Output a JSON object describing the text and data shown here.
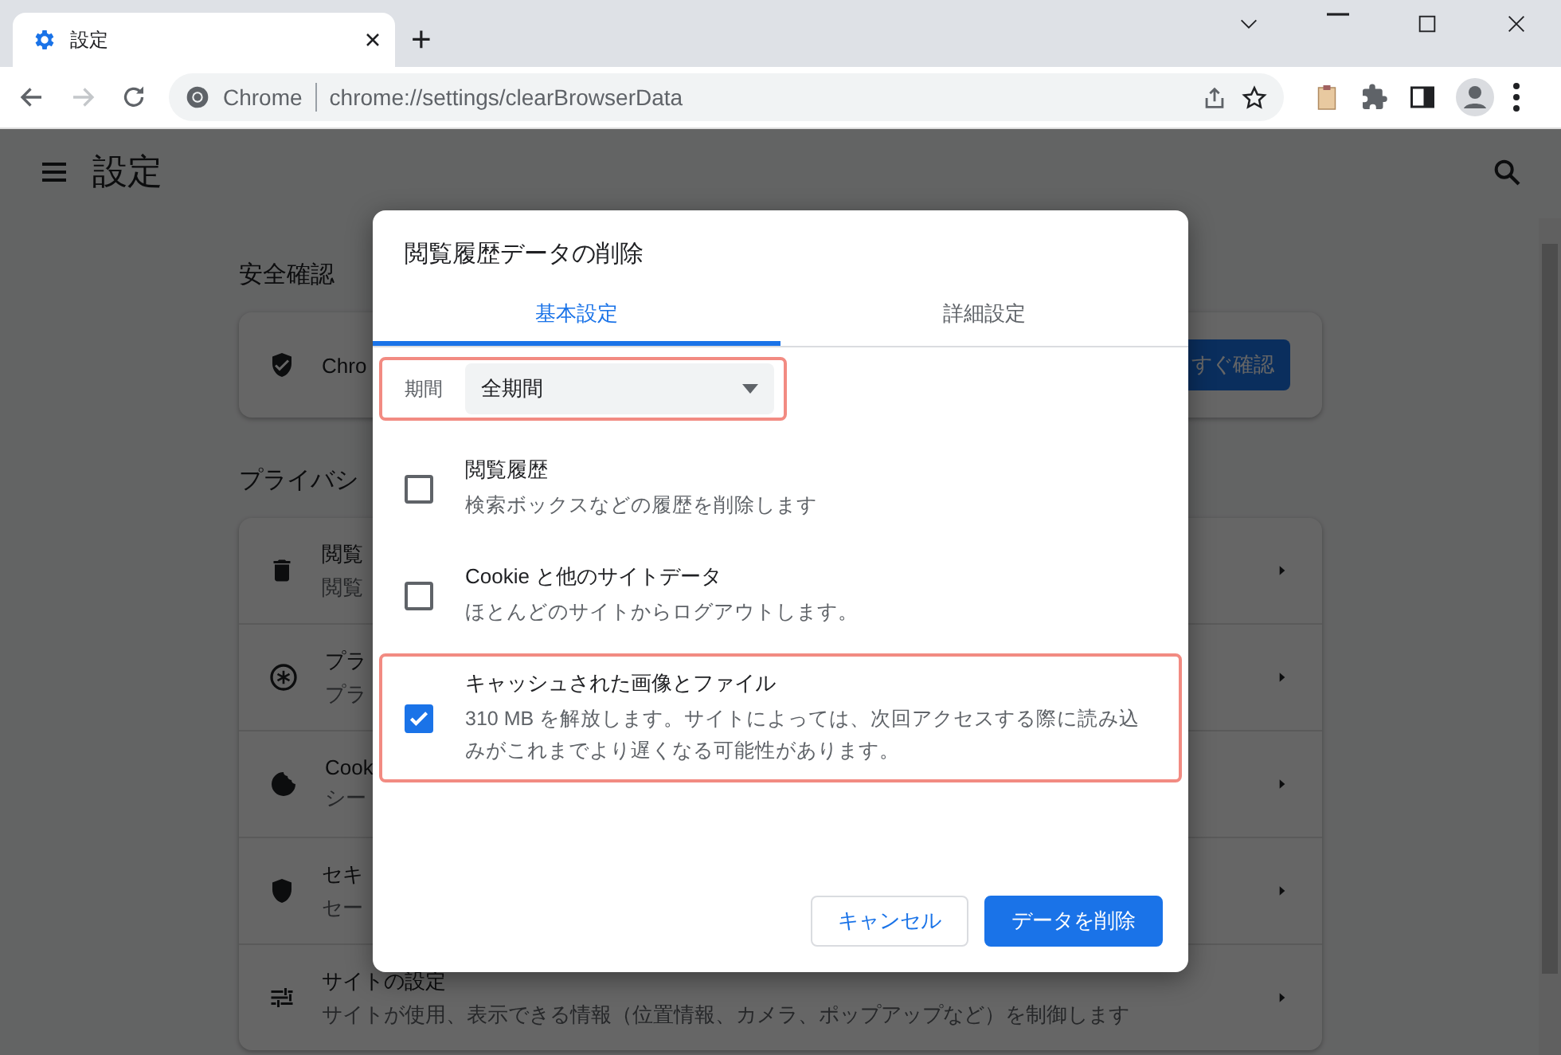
{
  "browser": {
    "tab": {
      "title": "設定"
    },
    "new_tab": "+",
    "omnibox": {
      "site": "Chrome",
      "url": "chrome://settings/clearBrowserData"
    },
    "forward_disabled": true
  },
  "settings_page": {
    "title": "設定",
    "safety_check": {
      "title": "安全確認",
      "text": "Chro",
      "button": "すぐ確認"
    },
    "privacy": {
      "title": "プライバシ",
      "rows": [
        {
          "title": "閲覧",
          "subtitle": "閲覧"
        },
        {
          "title": "プラ",
          "subtitle": "プラ"
        },
        {
          "title": "Cook",
          "subtitle": "シー"
        },
        {
          "title": "セキ",
          "subtitle": "セー"
        },
        {
          "title": "サイトの設定",
          "subtitle": "サイトが使用、表示できる情報（位置情報、カメラ、ポップアップなど）を制御します"
        }
      ]
    }
  },
  "dialog": {
    "title": "閲覧履歴データの削除",
    "tabs": [
      {
        "label": "基本設定",
        "selected": true
      },
      {
        "label": "詳細設定",
        "selected": false
      }
    ],
    "period": {
      "label": "期間",
      "value": "全期間",
      "highlighted": true
    },
    "items": [
      {
        "title": "閲覧履歴",
        "description": "検索ボックスなどの履歴を削除します",
        "checked": false,
        "highlighted": false
      },
      {
        "title": "Cookie と他のサイトデータ",
        "description": "ほとんどのサイトからログアウトします。",
        "checked": false,
        "highlighted": false
      },
      {
        "title": "キャッシュされた画像とファイル",
        "description": "310 MB を解放します。サイトによっては、次回アクセスする際に読み込みがこれまでより遅くなる可能性があります。",
        "checked": true,
        "highlighted": true
      }
    ],
    "buttons": [
      {
        "label": "キャンセル",
        "kind": "secondary"
      },
      {
        "label": "データを削除",
        "kind": "primary"
      }
    ]
  }
}
